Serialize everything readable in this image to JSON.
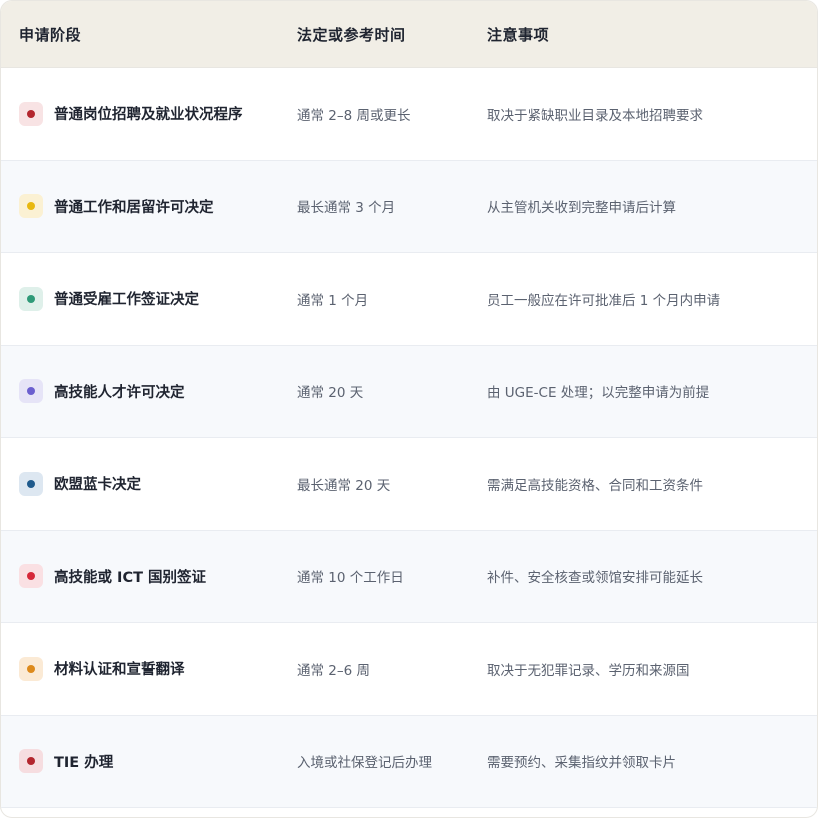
{
  "header": {
    "col_stage": "申请阶段",
    "col_time": "法定或参考时间",
    "col_note": "注意事项"
  },
  "rows": [
    {
      "stage": "普通岗位招聘及就业状况程序",
      "time": "通常 2–8 周或更长",
      "note": "取决于紧缺职业目录及本地招聘要求",
      "dot": "#b3262e",
      "tint": "#f8e3e4"
    },
    {
      "stage": "普通工作和居留许可决定",
      "time": "最长通常 3 个月",
      "note": "从主管机关收到完整申请后计算",
      "dot": "#e8b80f",
      "tint": "#fbf1d3"
    },
    {
      "stage": "普通受雇工作签证决定",
      "time": "通常 1 个月",
      "note": "员工一般应在许可批准后 1 个月内申请",
      "dot": "#2f9a78",
      "tint": "#dff0ea"
    },
    {
      "stage": "高技能人才许可决定",
      "time": "通常 20 天",
      "note": "由 UGE-CE 处理；以完整申请为前提",
      "dot": "#6b5fcf",
      "tint": "#e6e4f7"
    },
    {
      "stage": "欧盟蓝卡决定",
      "time": "最长通常 20 天",
      "note": "需满足高技能资格、合同和工资条件",
      "dot": "#1f5a8c",
      "tint": "#dde7f1"
    },
    {
      "stage": "高技能或 ICT 国别签证",
      "time": "通常 10 个工作日",
      "note": "补件、安全核查或领馆安排可能延长",
      "dot": "#d6283a",
      "tint": "#fae0e3"
    },
    {
      "stage": "材料认证和宣誓翻译",
      "time": "通常 2–6 周",
      "note": "取决于无犯罪记录、学历和来源国",
      "dot": "#dd8a1c",
      "tint": "#fbead5"
    },
    {
      "stage": "TIE 办理",
      "time": "入境或社保登记后办理",
      "note": "需要预约、采集指纹并领取卡片",
      "dot": "#b3262e",
      "tint": "#f6dde0"
    }
  ]
}
